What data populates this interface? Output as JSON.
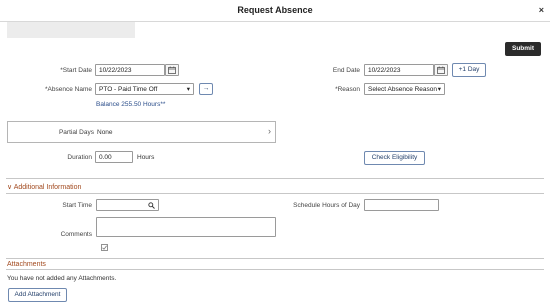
{
  "window": {
    "title": "Request Absence",
    "close_label": "×"
  },
  "toolbar": {
    "submit_label": "Submit"
  },
  "form": {
    "start_date": {
      "label": "*Start Date",
      "value": "10/22/2023"
    },
    "end_date": {
      "label": "End Date",
      "value": "10/22/2023"
    },
    "plus_day_label": "+1 Day",
    "absence_name": {
      "label": "*Absence Name",
      "value": "PTO - Paid Time Off",
      "arrow": "→"
    },
    "balance_text": "Balance 255.50 Hours**",
    "reason": {
      "label": "*Reason",
      "value": "Select Absence Reason"
    },
    "partial_days": {
      "label": "Partial Days",
      "value": "None",
      "chevron": "›"
    },
    "duration": {
      "label": "Duration",
      "value": "0.00",
      "unit": "Hours"
    },
    "check_eligibility_label": "Check Eligibility"
  },
  "additional_info": {
    "title": "Additional Information",
    "toggle": "∨",
    "start_time_label": "Start Time",
    "schedule_hours_label": "Schedule Hours of Day",
    "comments_label": "Comments"
  },
  "attachments": {
    "title": "Attachments",
    "empty_text": "You have not added any Attachments.",
    "add_label": "Add Attachment"
  },
  "icons": {
    "calendar": "calendar-icon",
    "search": "search-icon",
    "spellcheck": "spellcheck-icon"
  },
  "colors": {
    "section_title": "#a24a1f",
    "link": "#2a4d8a",
    "submit_bg": "#2b2b2b"
  }
}
